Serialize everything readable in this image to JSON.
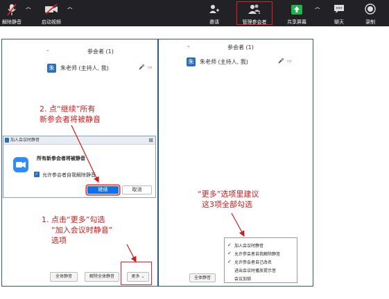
{
  "toolbar": {
    "unmute": "解除静音",
    "start_video": "启动视频",
    "invite": "邀请",
    "manage": "管理参会者",
    "share": "共享屏幕",
    "chat": "聊天",
    "record": "录制"
  },
  "left_panel": {
    "header": "参会者 (1)",
    "avatar": "朱",
    "name": "朱老师 (主持人, 我)",
    "mute_all": "全体静音",
    "unmute_all": "解除全体静音",
    "more": "更多 ⌄"
  },
  "right_panel": {
    "header": "参会者 (1)",
    "avatar": "朱",
    "name": "朱老师 (主持人, 我)",
    "mute_all": "全体静音"
  },
  "dialog": {
    "title": "加入会议时静音",
    "message": "所有新参会者将被静音",
    "checkbox": "允许参会者自我解除静音",
    "continue": "继续",
    "cancel": "取消",
    "close": "⊠"
  },
  "menu": {
    "items": [
      {
        "label": "加入会议时静音",
        "checked": true
      },
      {
        "label": "允许参会者自我解除静音",
        "checked": true
      },
      {
        "label": "允许参会者自己改名",
        "checked": true
      },
      {
        "label": "进出会议时播放提示音",
        "checked": false
      },
      {
        "label": "会议加锁",
        "checked": false
      }
    ]
  },
  "annotations": {
    "a2_line1": "2. 点“继续”所有",
    "a2_line2": "新参会者将被静音",
    "a1_line1": "1. 点击“更多”勾选",
    "a1_line2": "“加入会议时静音”",
    "a1_line3": "选项",
    "ar_line1": "“更多”选项里建议",
    "ar_line2": "这3项全部勾选"
  },
  "colors": {
    "annotation": "#d21a1a",
    "accent": "#2a6fb7",
    "toolbar": "#222226"
  }
}
